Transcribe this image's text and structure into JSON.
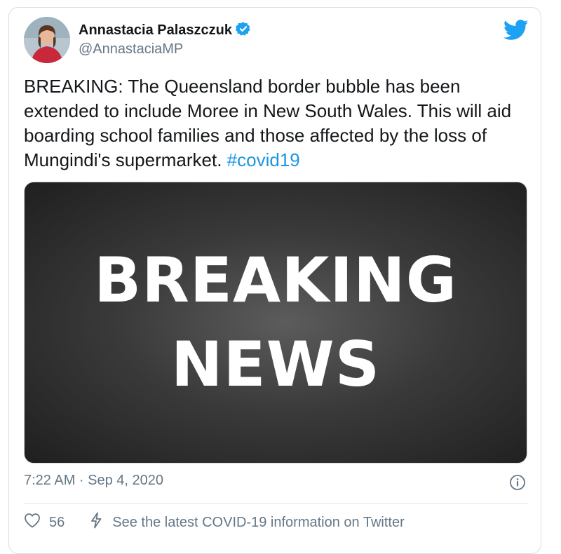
{
  "tweet": {
    "author_name": "Annastacia Palaszczuk",
    "handle": "@AnnastaciaMP",
    "text": "BREAKING: The Queensland border bubble has been extended to include Moree in New South Wales. This will aid boarding school families and those affected by the loss of Mungindi's supermarket. ",
    "hashtag": "#covid19",
    "media_line1": "BREAKING",
    "media_line2": "NEWS",
    "timestamp": "7:22 AM · Sep 4, 2020",
    "like_count": "56",
    "covid_info": "See the latest COVID-19 information on Twitter"
  },
  "icons": {
    "verified": "verified-badge-icon",
    "brand": "twitter-bird-icon",
    "info": "info-icon",
    "like": "heart-icon",
    "covid": "lightning-icon"
  },
  "colors": {
    "link": "#1b95e0",
    "secondary_text": "#657786",
    "twitter_blue": "#1da1f2"
  }
}
